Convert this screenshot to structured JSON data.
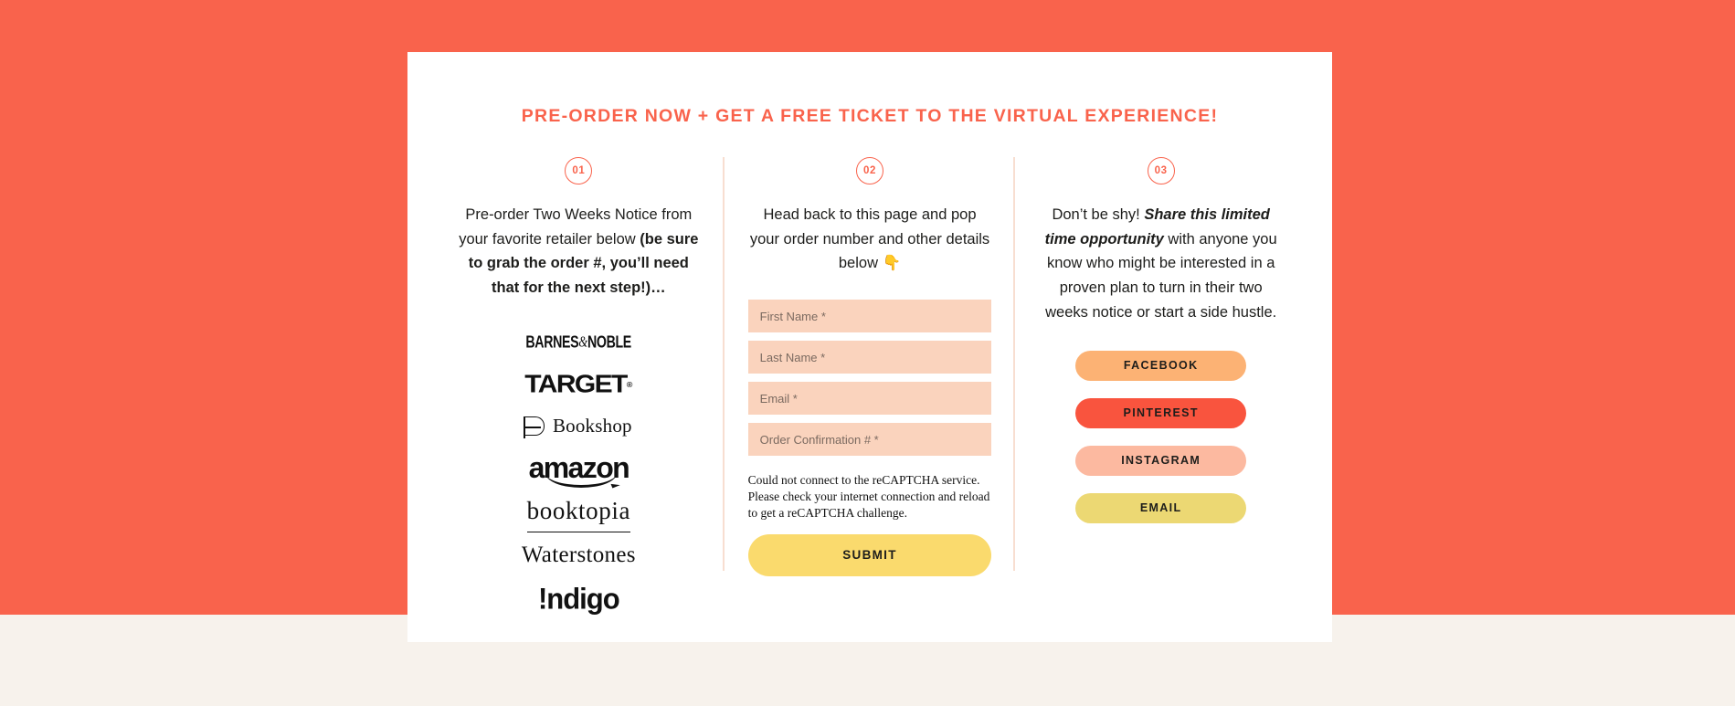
{
  "page": {
    "background_color": "#f9634c",
    "lower_band_color": "#f7f2ec",
    "card_color": "#ffffff",
    "accent_color": "#f9634c"
  },
  "headline": "PRE-ORDER NOW + GET A FREE TICKET TO THE VIRTUAL EXPERIENCE!",
  "columns": [
    {
      "number": "01",
      "text_parts": {
        "plain_1": "Pre-order Two Weeks Notice from your favorite retailer below ",
        "bold_1": "(be sure to grab the order #, you’ll need that for the next step!)…"
      },
      "retailers": [
        {
          "name": "BARNES&NOBLE",
          "label_a": "BARNES",
          "label_amp": "&",
          "label_b": "NOBLE"
        },
        {
          "name": "TARGET",
          "label": "TARGET",
          "mark": "®"
        },
        {
          "name": "Bookshop",
          "label": "Bookshop"
        },
        {
          "name": "amazon",
          "label": "amazon"
        },
        {
          "name": "booktopia",
          "label": "booktopia"
        },
        {
          "name": "Waterstones",
          "label": "Waterstones"
        },
        {
          "name": "Indigo",
          "label": "!ndigo"
        }
      ]
    },
    {
      "number": "02",
      "text": "Head back to this page and pop your order number and other details below 👇",
      "form": {
        "fields": [
          {
            "name": "first-name",
            "placeholder": "First Name *",
            "value": ""
          },
          {
            "name": "last-name",
            "placeholder": "Last Name *",
            "value": ""
          },
          {
            "name": "email",
            "placeholder": "Email *",
            "value": ""
          },
          {
            "name": "order-confirmation",
            "placeholder": "Order Confirmation # *",
            "value": ""
          }
        ],
        "captcha_error": "Could not connect to the reCAPTCHA service. Please check your internet connection and reload to get a reCAPTCHA challenge.",
        "submit_label": "SUBMIT",
        "submit_color": "#fada6d",
        "field_color": "#fad3bd"
      }
    },
    {
      "number": "03",
      "text_parts": {
        "plain_1": "Don’t be shy! ",
        "bold_italic": "Share this limited time opportunity",
        "plain_2": " with anyone you know who might be interested in a proven plan to turn in their two weeks notice or start a side hustle."
      },
      "share_buttons": [
        {
          "label": "FACEBOOK",
          "color": "#fcb274"
        },
        {
          "label": "PINTEREST",
          "color": "#f9543e"
        },
        {
          "label": "INSTAGRAM",
          "color": "#fcb9a0"
        },
        {
          "label": "EMAIL",
          "color": "#ecd873"
        }
      ]
    }
  ]
}
